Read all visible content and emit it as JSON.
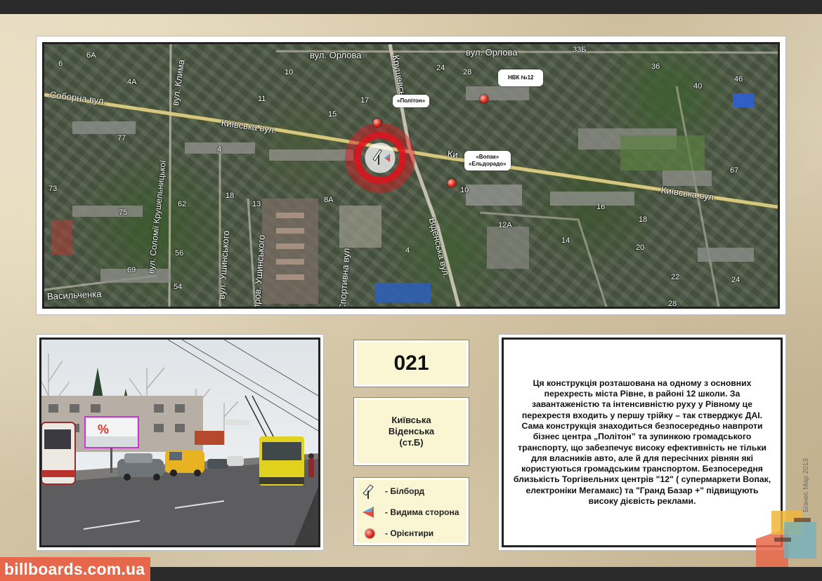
{
  "map": {
    "streets": [
      {
        "id": "orlova-1",
        "text": "вул. Орлова"
      },
      {
        "id": "orlova-2",
        "text": "вул. Орлова"
      },
      {
        "id": "soborna",
        "text": "Соборна вул."
      },
      {
        "id": "kyivska-1",
        "text": "Київська вул."
      },
      {
        "id": "kyivska-2",
        "text": "Київська вул."
      },
      {
        "id": "kyivska-3",
        "text": "Ки"
      },
      {
        "id": "klyma",
        "text": "вул. Клима"
      },
      {
        "id": "solomii",
        "text": "вул. Соломії Крушельницької"
      },
      {
        "id": "ushynskoho-1",
        "text": "вул. Ушинського"
      },
      {
        "id": "ushynskoho-2",
        "text": "пров. Ушинського"
      },
      {
        "id": "sportyvna",
        "text": "Спортивна вул."
      },
      {
        "id": "vidinska",
        "text": "Віденська вул."
      },
      {
        "id": "krushevska",
        "text": "Крушевськ"
      },
      {
        "id": "vasylchenka",
        "text": "Васильченка"
      }
    ],
    "house_numbers": [
      "6А",
      "6",
      "4А",
      "10",
      "17",
      "15",
      "11",
      "24",
      "28",
      "33Б",
      "36",
      "40",
      "46",
      "4",
      "77",
      "73",
      "75",
      "62",
      "56",
      "54",
      "69",
      "18",
      "13",
      "8А",
      "4",
      "10",
      "16",
      "18",
      "12А",
      "14",
      "20",
      "22",
      "24",
      "28",
      "67"
    ],
    "callouts": {
      "polyton": "«Політон»",
      "nvk": "НВК №12",
      "vopak_1": "«Вопак»",
      "vopak_2": "«Ельдорадо»"
    }
  },
  "photo": {
    "billboard_text": "%"
  },
  "code": "021",
  "address": {
    "line1": "Київська",
    "line2": "Віденська",
    "line3": "(ст.Б)"
  },
  "legend": [
    {
      "icon": "billboard-icon",
      "label": "- Білборд"
    },
    {
      "icon": "visible-side-icon",
      "label": "- Видима сторона"
    },
    {
      "icon": "landmark-icon",
      "label": "- Орієнтири"
    }
  ],
  "description": "Ця конструкція розташована на одному з основних перехресть міста Рівне, в районі 12 школи. За завантаженістю та інтенсивністю руху у Рівному це перехрестя входить у першу трійку – так стверджує ДАІ. Сама конструкція знаходиться безпосередньо навпроти бізнес центра „Політон” та зупинкою громадського транспорту, що забезпечує високу ефективність не тільки для власників авто, але й для пересічних рівнян які користуються громадським транспортом. Безпосередня близькість Торгівельних центрів \"12\" ( супермаркети Вопак, електроніки Мегамакс) та \"Гранд Базар +\" підвищують високу дієвість реклами.",
  "brand": "billboards.com.ua",
  "logo_caption": "Бізнес Мар 2013",
  "colors": {
    "brand_bg": "#e7674a",
    "info_bg": "#faf6d3",
    "ring": "#dc141e",
    "bar": "#2a2a2a"
  }
}
